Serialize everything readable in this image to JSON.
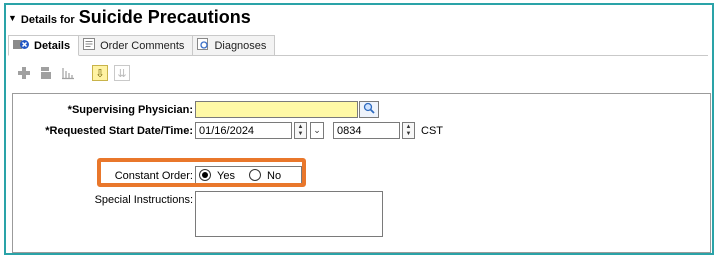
{
  "header": {
    "details_for": "Details for",
    "title": "Suicide Precautions"
  },
  "tabs": [
    {
      "label": "Details",
      "icon": "details-icon"
    },
    {
      "label": "Order Comments",
      "icon": "comments-icon"
    },
    {
      "label": "Diagnoses",
      "icon": "diagnoses-icon"
    }
  ],
  "toolbar": {
    "icons": [
      "add-icon",
      "remove-icon",
      "chart-icon",
      "down-arrow-icon",
      "down-double-icon"
    ]
  },
  "form": {
    "supervising_physician": {
      "label": "*Supervising Physician:",
      "value": ""
    },
    "requested_start": {
      "label": "*Requested Start Date/Time:",
      "date": "01/16/2024",
      "time": "0834",
      "timezone": "CST"
    },
    "constant_order": {
      "label": "Constant Order:",
      "options": [
        "Yes",
        "No"
      ],
      "selected": "Yes"
    },
    "special_instructions": {
      "label": "Special Instructions:",
      "value": ""
    }
  },
  "colors": {
    "frame_border": "#2aa3a8",
    "highlight": "#e9772b",
    "required_field": "#fff9a6"
  }
}
